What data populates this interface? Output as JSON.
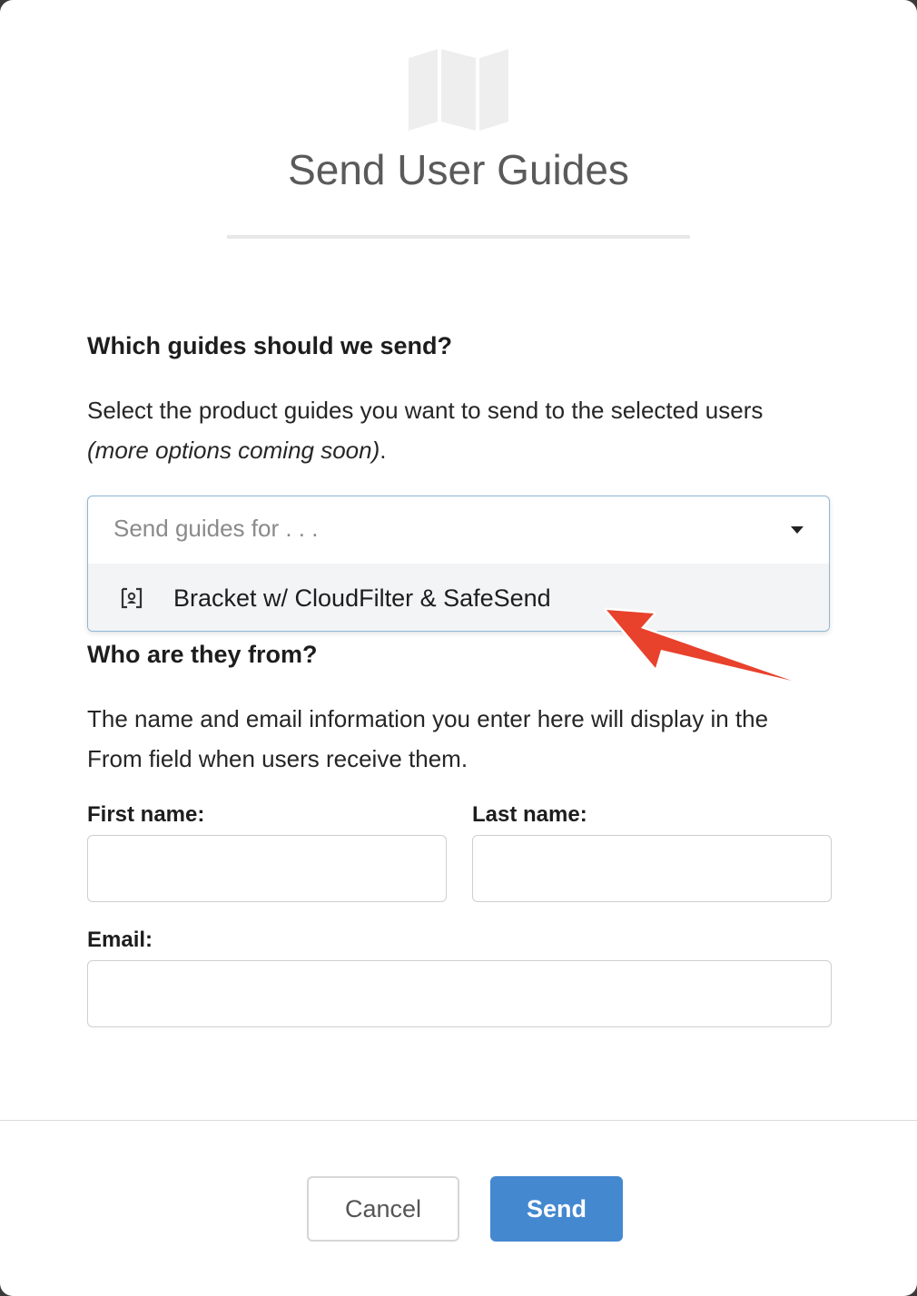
{
  "dialog": {
    "title": "Send User Guides",
    "header_icon": "map-icon"
  },
  "guides_section": {
    "heading": "Which guides should we send?",
    "description": "Select the product guides you want to send to the selected users",
    "note": "(more options coming soon)",
    "note_suffix": ".",
    "select": {
      "placeholder": "Send guides for . . .",
      "options": [
        {
          "label": "Bracket w/ CloudFilter & SafeSend",
          "icon": "device-icon"
        }
      ]
    }
  },
  "from_section": {
    "heading": "Who are they from?",
    "description": "The name and email information you enter here will display in the From field when users receive them.",
    "first_name_label": "First name:",
    "first_name_value": "",
    "last_name_label": "Last name:",
    "last_name_value": "",
    "email_label": "Email:",
    "email_value": ""
  },
  "footer": {
    "cancel_label": "Cancel",
    "send_label": "Send"
  },
  "colors": {
    "primary": "#4488d0",
    "annotation_arrow": "#e8412c"
  }
}
